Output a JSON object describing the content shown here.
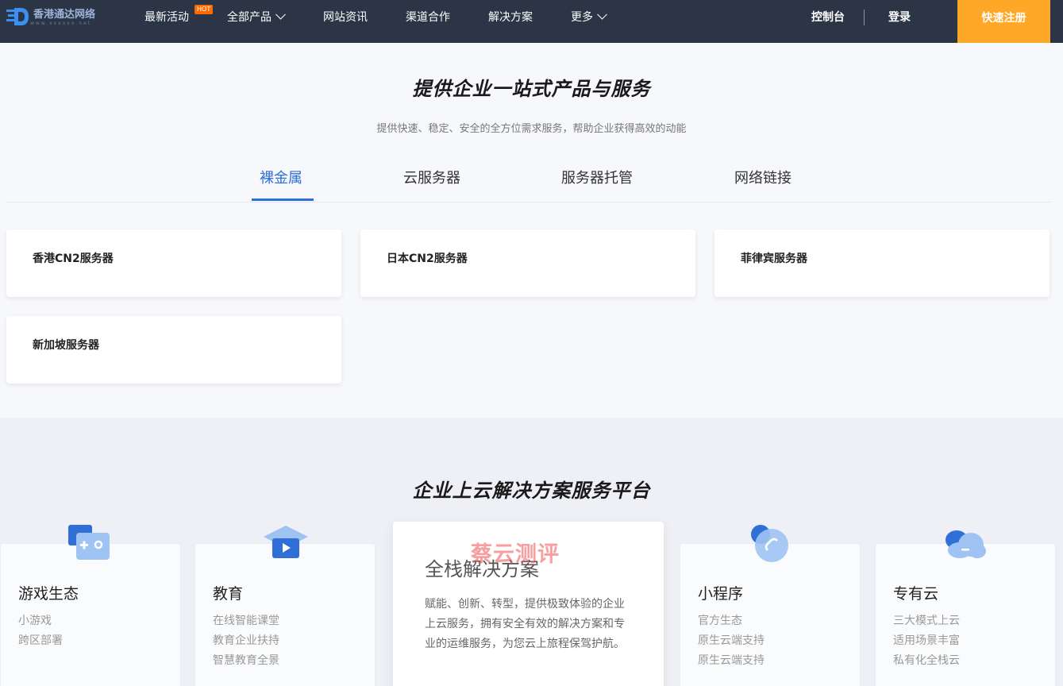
{
  "nav": {
    "logo_text": "香港通达网络",
    "logo_sub": "www.xxxxxx.net",
    "items": [
      "最新活动",
      "全部产品",
      "网站资讯",
      "渠道合作",
      "解决方案",
      "更多"
    ],
    "hot_badge": "HOT",
    "console": "控制台",
    "login": "登录",
    "signup": "快速注册"
  },
  "products": {
    "title": "提供企业一站式产品与服务",
    "subtitle": "提供快速、稳定、安全的全方位需求服务，帮助企业获得高效的动能",
    "tabs": [
      "裸金属",
      "云服务器",
      "服务器托管",
      "网络链接"
    ],
    "active_tab": "裸金属",
    "cards": [
      "香港CN2服务器",
      "日本CN2服务器",
      "菲律宾服务器",
      "新加坡服务器"
    ]
  },
  "solutions": {
    "title": "企业上云解决方案服务平台",
    "items": [
      {
        "title": "游戏生态",
        "icon": "gamepad-icon",
        "lines": [
          "小游戏",
          "跨区部署"
        ]
      },
      {
        "title": "教育",
        "icon": "graduation-cap-icon",
        "lines": [
          "在线智能课堂",
          "教育企业扶持",
          "智慧教育全景"
        ]
      },
      {
        "title": "小程序",
        "icon": "mini-program-icon",
        "lines": [
          "官方生态",
          "原生云端支持",
          "原生云端支持"
        ]
      },
      {
        "title": "专有云",
        "icon": "cloud-icon",
        "lines": [
          "三大模式上云",
          "适用场景丰富",
          "私有化全栈云"
        ]
      }
    ],
    "featured": {
      "title": "全栈解决方案",
      "desc": "赋能、创新、转型，提供极致体验的企业上云服务，拥有安全有效的解决方案和专业的运维服务，为您云上旅程保驾护航。"
    },
    "watermark": "蔡云测评"
  },
  "colors": {
    "nav_bg": "#2b3546",
    "accent": "#2f6fd6",
    "signup": "#ffa726",
    "hot": "#ff6a00"
  }
}
